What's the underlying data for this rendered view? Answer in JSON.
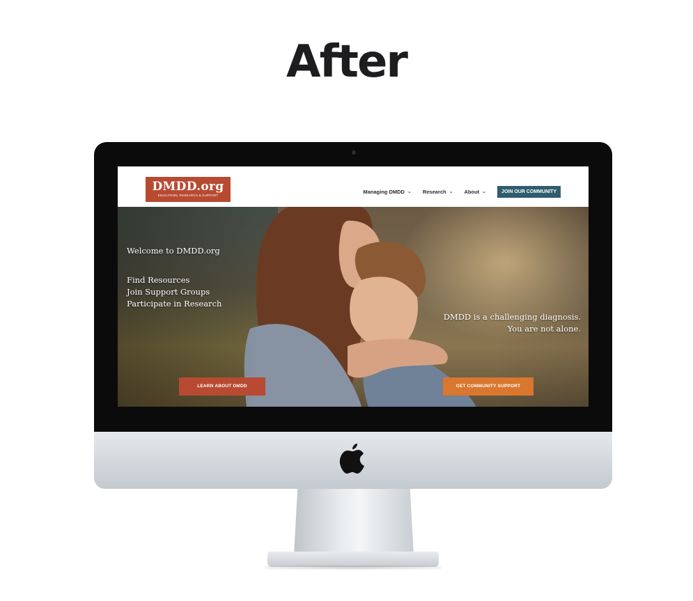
{
  "heading": "After",
  "site": {
    "logo": {
      "name": "DMDD.org",
      "tagline": "EDUCATION, RESEARCH & SUPPORT"
    },
    "nav": {
      "items": [
        {
          "label": "Managing DMDD"
        },
        {
          "label": "Research"
        },
        {
          "label": "About"
        }
      ],
      "cta": "JOIN OUR COMMUNITY"
    },
    "hero": {
      "welcome": "Welcome to DMDD.org",
      "links": [
        "Find Resources",
        "Join Support Groups",
        "Participate in Research"
      ],
      "tagline_line1": "DMDD is a challenging diagnosis.",
      "tagline_line2": "You are not alone.",
      "learn_button": "LEARN ABOUT DMDD",
      "support_button": "GET COMMUNITY SUPPORT"
    }
  },
  "colors": {
    "logo_bg": "#b84a32",
    "cta_bg": "#2f5d6e",
    "learn_button_bg": "#b84a32",
    "support_button_bg": "#d9772f",
    "heading_text": "#1d1d1f"
  },
  "icons": {
    "monitor_logo": "apple-logo-icon",
    "nav_dropdown": "chevron-down-icon"
  }
}
